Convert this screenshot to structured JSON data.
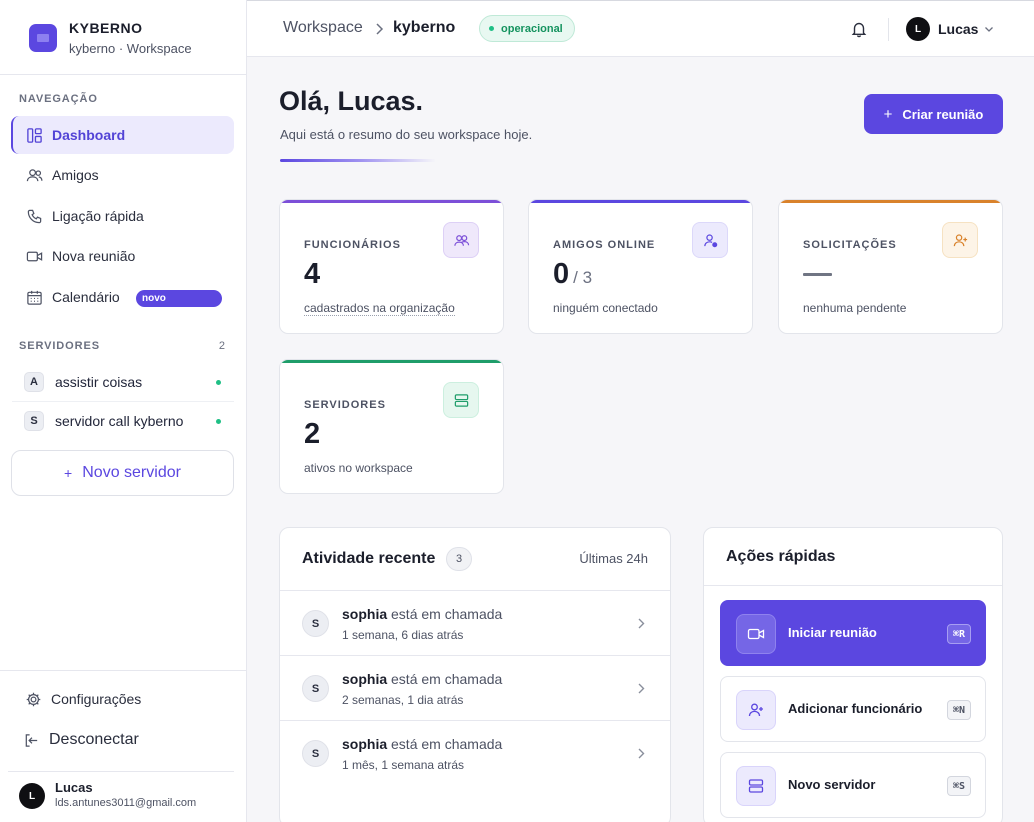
{
  "brand": {
    "name": "KYBERNO",
    "subtitle": "kyberno · Workspace"
  },
  "sidebar": {
    "nav_label": "NAVEGAÇÃO",
    "items": [
      {
        "label": "Dashboard",
        "icon": "dashboard-icon"
      },
      {
        "label": "Amigos",
        "icon": "users-icon"
      },
      {
        "label": "Ligação rápida",
        "icon": "phone-icon"
      },
      {
        "label": "Nova reunião",
        "icon": "video-icon"
      },
      {
        "label": "Calendário",
        "icon": "calendar-icon",
        "badge": "novo"
      }
    ],
    "servers_label": "SERVIDORES",
    "servers_count": "2",
    "servers": [
      {
        "initial": "A",
        "name": "assistir coisas"
      },
      {
        "initial": "S",
        "name": "servidor call kyberno"
      }
    ],
    "new_server": "Novo servidor",
    "settings": "Configurações",
    "logout": "Desconectar",
    "user": {
      "initial": "L",
      "name": "Lucas",
      "email": "lds.antunes3011@gmail.com"
    }
  },
  "header": {
    "breadcrumb": [
      "Workspace",
      "kyberno"
    ],
    "status": "operacional",
    "user": {
      "initial": "L",
      "name": "Lucas"
    }
  },
  "main": {
    "greeting": "Olá, Lucas.",
    "subtitle": "Aqui está o resumo do seu workspace hoje.",
    "create_button": "Criar reunião",
    "stats": [
      {
        "label": "FUNCIONÁRIOS",
        "value": "4",
        "sub": "cadastrados na organização",
        "accent": "#7c4fd8"
      },
      {
        "label": "AMIGOS ONLINE",
        "value": "0",
        "of": "/ 3",
        "sub": "ninguém conectado",
        "accent": "#5b47e0"
      },
      {
        "label": "SOLICITAÇÕES",
        "value": "—",
        "sub": "nenhuma pendente",
        "accent": "#d9822b"
      },
      {
        "label": "SERVIDORES",
        "value": "2",
        "sub": "ativos no workspace",
        "accent": "#1f9d6a"
      }
    ],
    "activity": {
      "title": "Atividade recente",
      "count": "3",
      "range": "Últimas 24h",
      "items": [
        {
          "initial": "S",
          "user": "sophia",
          "action": "está em chamada",
          "time": "1 semana, 6 dias atrás"
        },
        {
          "initial": "S",
          "user": "sophia",
          "action": "está em chamada",
          "time": "2 semanas, 1 dia atrás"
        },
        {
          "initial": "S",
          "user": "sophia",
          "action": "está em chamada",
          "time": "1 mês, 1 semana atrás"
        }
      ]
    },
    "quick_actions": {
      "title": "Ações rápidas",
      "items": [
        {
          "label": "Iniciar reunião",
          "kbd": "⌘R",
          "icon": "video-icon"
        },
        {
          "label": "Adicionar funcionário",
          "kbd": "⌘N",
          "icon": "user-plus-icon"
        },
        {
          "label": "Novo servidor",
          "kbd": "⌘S",
          "icon": "server-icon"
        }
      ]
    }
  }
}
